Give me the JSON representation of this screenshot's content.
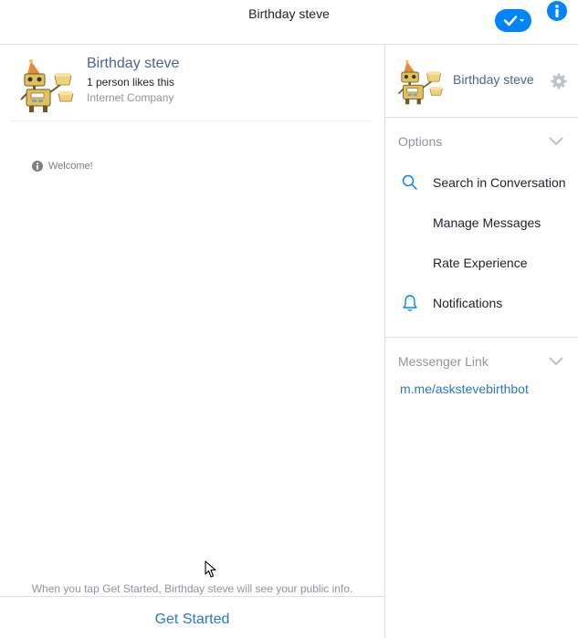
{
  "topbar": {
    "title": "Birthday steve"
  },
  "page": {
    "name": "Birthday steve",
    "likes": "1 person likes this",
    "category": "Internet Company"
  },
  "chat": {
    "welcome": "Welcome!",
    "public_info_notice": "When you tap Get Started, Birthday steve will see your public info.",
    "get_started_label": "Get Started"
  },
  "right_panel": {
    "name": "Birthday steve",
    "options_label": "Options",
    "options": [
      {
        "label": "Search in Conversation",
        "icon": "search-icon"
      },
      {
        "label": "Manage Messages",
        "icon": ""
      },
      {
        "label": "Rate Experience",
        "icon": ""
      },
      {
        "label": "Notifications",
        "icon": "bell-icon"
      }
    ],
    "messenger_link_label": "Messenger Link",
    "messenger_link": "m.me/askstevebirthbot"
  },
  "colors": {
    "accent": "#0084ff",
    "link": "#2a77c9",
    "name": "#4b6391",
    "muted": "#90949c",
    "divider": "#dddfe2"
  }
}
